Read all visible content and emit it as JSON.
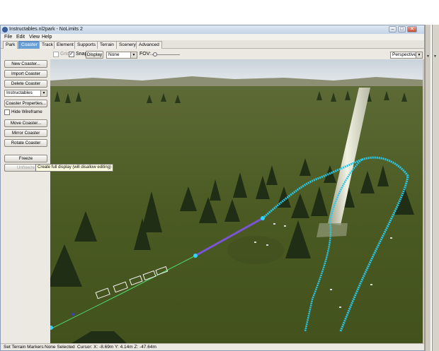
{
  "window": {
    "title": "Instructables.nl2park - NoLimits 2",
    "min_label": "–",
    "max_label": "□",
    "close_label": "✕"
  },
  "menu": [
    "File",
    "Edit",
    "View",
    "Help"
  ],
  "tabs": [
    "Park",
    "Coaster",
    "Track",
    "Element",
    "Supports",
    "Terrain",
    "Scenery",
    "Advanced"
  ],
  "active_tab": "Coaster",
  "toolbar": {
    "grid_label": "Grid",
    "grid_checked": false,
    "snap_label": "Snap",
    "snap_checked": true,
    "display_button": "Display",
    "display_select": "None",
    "fov_label": "FOV:",
    "view_select": "Perspective"
  },
  "left_panel": {
    "new_coaster": "New Coaster...",
    "import_coaster": "Import Coaster",
    "delete_coaster": "Delete Coaster",
    "coaster_select": "Instructables",
    "coaster_properties": "Coaster Properties...",
    "hide_wireframe_label": "Hide Wireframe",
    "hide_wireframe_checked": false,
    "move_coaster": "Move Coaster...",
    "mirror_coaster": "Mirror Coaster",
    "rotate_coaster": "Rotate Coaster",
    "freeze": "Freeze",
    "unfreeze": "Unfreeze"
  },
  "tooltip": "Create full display (will disallow editing)",
  "status": {
    "mode": "Set Terrain Markers",
    "selection": "None Selected",
    "cursor": "Cursor: X: -8.69m Y: 4.14m Z: -47.64m"
  },
  "colors": {
    "active_tab": "#6a9fd6",
    "sky": "#dfe6ea",
    "grass": "#4f5e25",
    "track": "#29c8e8",
    "lift": "#7a55d8"
  }
}
